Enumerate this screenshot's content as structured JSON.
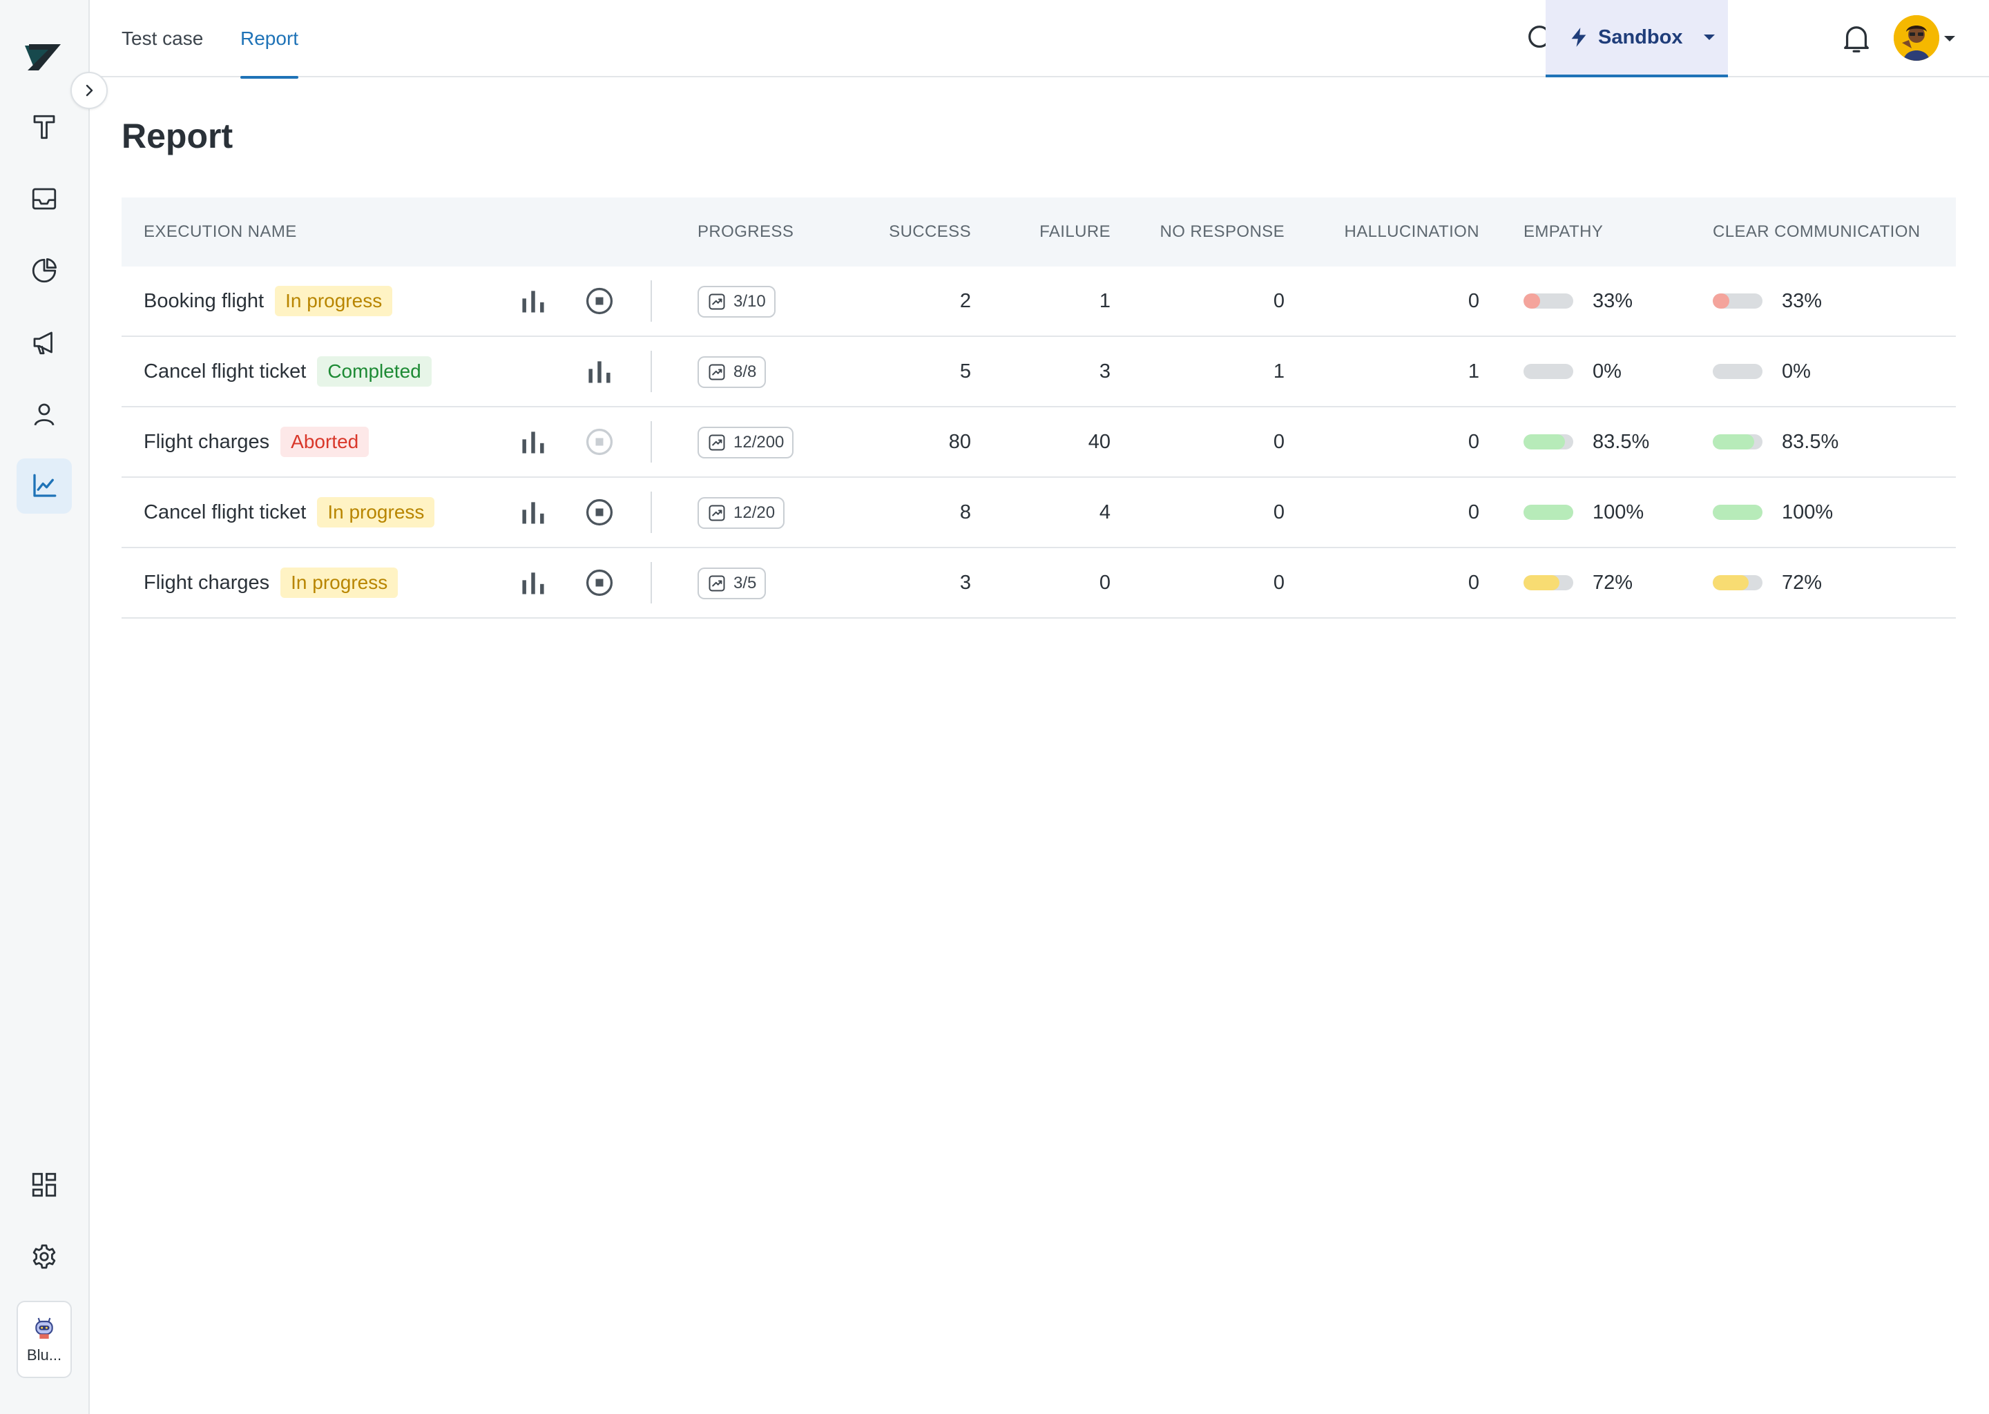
{
  "header": {
    "tabs": [
      {
        "label": "Test case",
        "active": false
      },
      {
        "label": "Report",
        "active": true
      }
    ],
    "environment": "Sandbox"
  },
  "sidebar": {
    "items": [
      {
        "icon": "formatting-icon"
      },
      {
        "icon": "inbox-icon"
      },
      {
        "icon": "pie-chart-icon"
      },
      {
        "icon": "megaphone-icon"
      },
      {
        "icon": "user-icon"
      },
      {
        "icon": "line-chart-icon",
        "active": true
      }
    ],
    "bottom_items": [
      {
        "icon": "dashboard-icon"
      },
      {
        "icon": "gear-icon"
      }
    ],
    "bot_label": "Blu..."
  },
  "page": {
    "title": "Report"
  },
  "table": {
    "columns": {
      "name": "EXECUTION NAME",
      "progress": "PROGRESS",
      "success": "SUCCESS",
      "failure": "FAILURE",
      "no_response": "NO RESPONSE",
      "hallucination": "HALLUCINATION",
      "empathy": "EMPATHY",
      "clear_communication": "CLEAR COMMUNICATION"
    },
    "rows": [
      {
        "name": "Booking flight",
        "status": "In progress",
        "progress": "3/10",
        "success": "2",
        "failure": "1",
        "no_response": "0",
        "hallucination": "0",
        "empathy": "33%",
        "empathy_value": 0.33,
        "clear_communication": "33%",
        "clear_communication_value": 0.33
      },
      {
        "name": "Cancel flight ticket",
        "status": "Completed",
        "progress": "8/8",
        "success": "5",
        "failure": "3",
        "no_response": "1",
        "hallucination": "1",
        "empathy": "0%",
        "empathy_value": 0,
        "clear_communication": "0%",
        "clear_communication_value": 0
      },
      {
        "name": "Flight charges",
        "status": "Aborted",
        "progress": "12/200",
        "success": "80",
        "failure": "40",
        "no_response": "0",
        "hallucination": "0",
        "empathy": "83.5%",
        "empathy_value": 0.835,
        "clear_communication": "83.5%",
        "clear_communication_value": 0.835
      },
      {
        "name": "Cancel flight ticket",
        "status": "In progress",
        "progress": "12/20",
        "success": "8",
        "failure": "4",
        "no_response": "0",
        "hallucination": "0",
        "empathy": "100%",
        "empathy_value": 1.0,
        "clear_communication": "100%",
        "clear_communication_value": 1.0
      },
      {
        "name": "Flight charges",
        "status": "In progress",
        "progress": "3/5",
        "success": "3",
        "failure": "0",
        "no_response": "0",
        "hallucination": "0",
        "empathy": "72%",
        "empathy_value": 0.72,
        "clear_communication": "72%",
        "clear_communication_value": 0.72
      }
    ]
  },
  "colors": {
    "accent": "#1f73b7",
    "bar_low": "#f4a49c",
    "bar_high": "#b7ebb9",
    "bar_mid": "#f8dc72"
  }
}
